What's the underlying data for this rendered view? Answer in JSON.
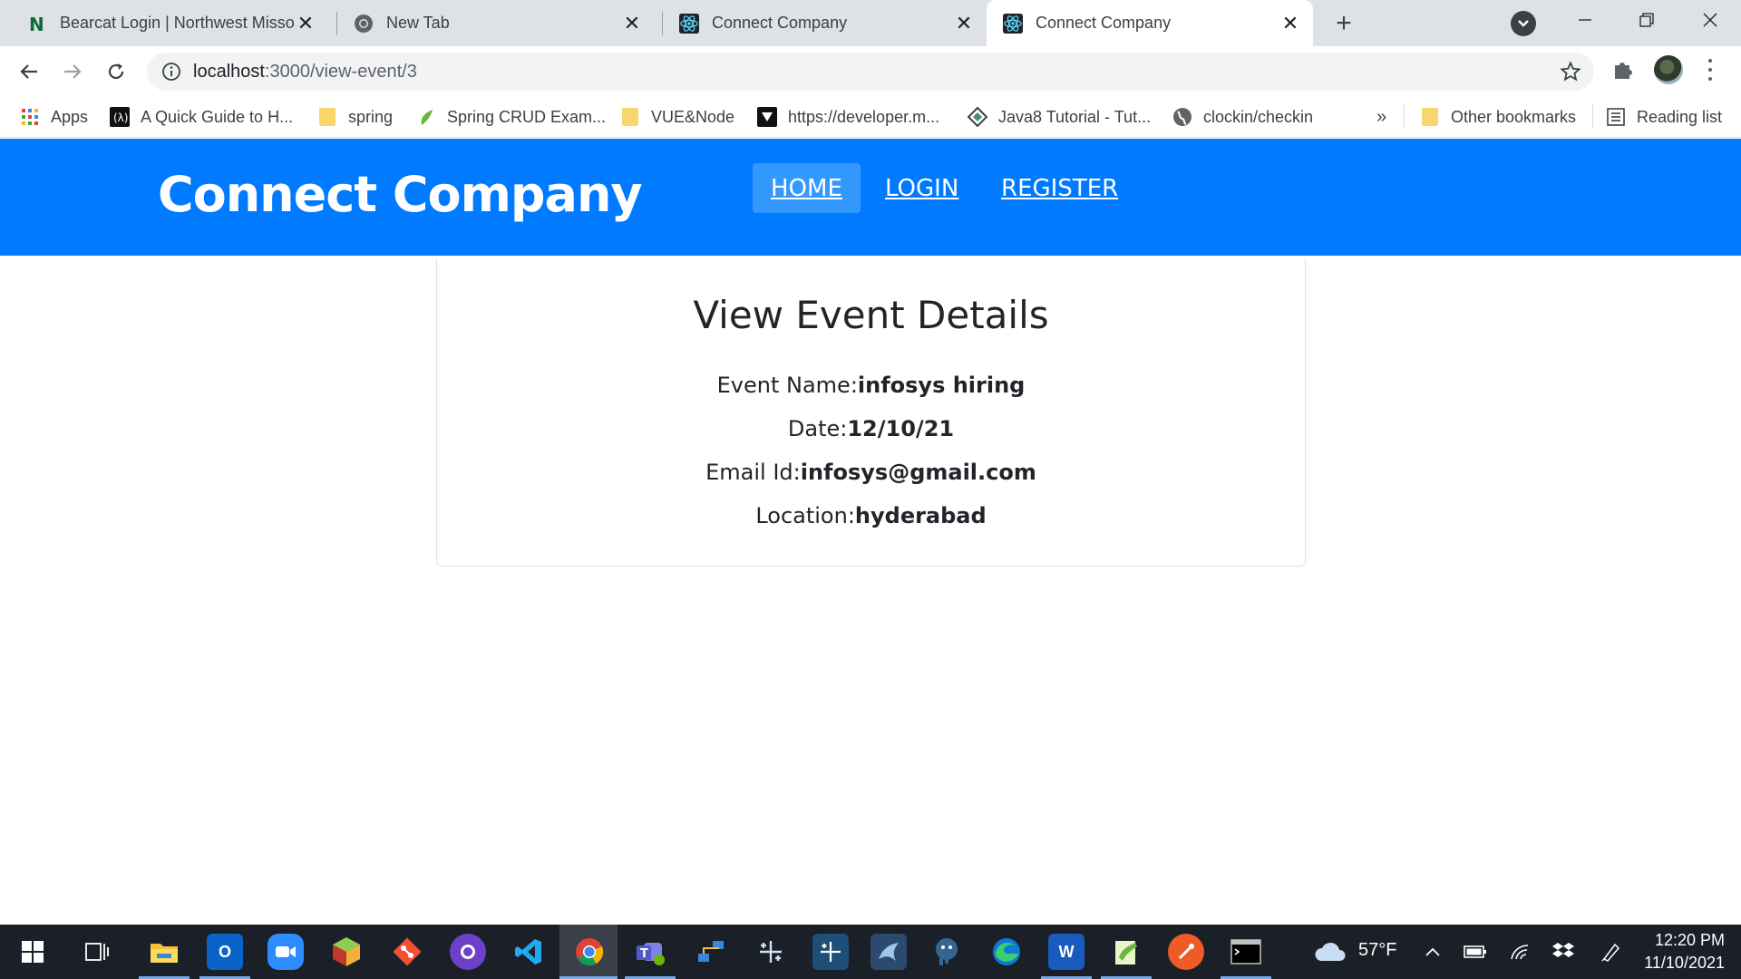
{
  "browser": {
    "tabs": [
      {
        "title": "Bearcat Login | Northwest Missou",
        "icon": "northwest-n-icon",
        "active": false
      },
      {
        "title": "New Tab",
        "icon": "chrome-icon",
        "active": false
      },
      {
        "title": "Connect Company",
        "icon": "react-icon",
        "active": false
      },
      {
        "title": "Connect Company",
        "icon": "react-icon",
        "active": true
      }
    ],
    "address": {
      "host": "localhost",
      "path": ":3000/view-event/3"
    },
    "bookmarks": [
      {
        "label": "Apps",
        "icon": "apps-grid-icon"
      },
      {
        "label": "A Quick Guide to H...",
        "icon": "site-icon"
      },
      {
        "label": "spring",
        "icon": "folder-icon"
      },
      {
        "label": "Spring CRUD Exam...",
        "icon": "spring-leaf-icon"
      },
      {
        "label": "VUE&Node",
        "icon": "folder-icon"
      },
      {
        "label": "https://developer.m...",
        "icon": "site-icon"
      },
      {
        "label": "Java8 Tutorial - Tut...",
        "icon": "site-icon"
      },
      {
        "label": "clockin/checkin",
        "icon": "globe-icon"
      }
    ],
    "overflow": "»",
    "other_bookmarks": "Other bookmarks",
    "reading_list": "Reading list"
  },
  "page": {
    "brand": "Connect Company",
    "nav": [
      {
        "label": "HOME",
        "active": true
      },
      {
        "label": "LOGIN",
        "active": false
      },
      {
        "label": "REGISTER",
        "active": false
      }
    ],
    "card": {
      "heading": "View Event Details",
      "fields": [
        {
          "label": "Event Name:",
          "value": "infosys hiring"
        },
        {
          "label": "Date:",
          "value": "12/10/21"
        },
        {
          "label": "Email Id:",
          "value": "infosys@gmail.com"
        },
        {
          "label": "Location:",
          "value": "hyderabad"
        }
      ]
    }
  },
  "taskbar": {
    "weather": "57°F",
    "time": "12:20 PM",
    "date": "11/10/2021",
    "apps": [
      "start-icon",
      "task-view-icon",
      "file-explorer-icon",
      "outlook-icon",
      "zoom-icon",
      "app-cube-icon",
      "git-icon",
      "github-desktop-icon",
      "vscode-icon",
      "chrome-icon",
      "teams-icon",
      "network-icon",
      "tableau-icon",
      "tableau-icon",
      "mysql-workbench-icon",
      "postgres-icon",
      "edge-icon",
      "word-icon",
      "notepad-plus-icon",
      "postman-icon",
      "terminal-icon"
    ]
  },
  "colors": {
    "header": "#007bff",
    "nav_active": "#3399ff",
    "tab_strip": "#dee1e6",
    "taskbar": "#1b1f28"
  }
}
